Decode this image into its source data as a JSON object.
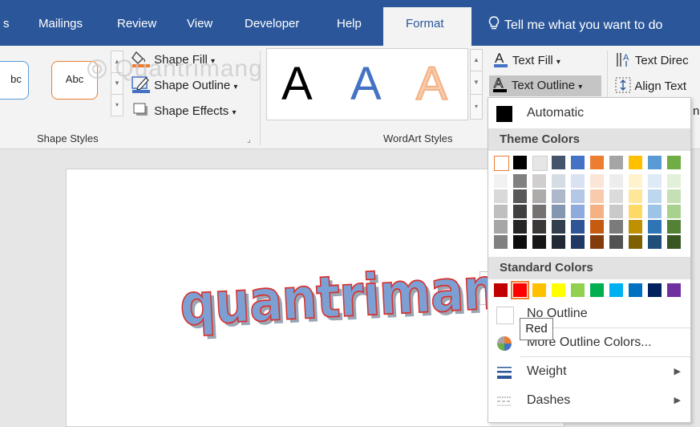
{
  "tabs": [
    "s",
    "Mailings",
    "Review",
    "View",
    "Developer",
    "Help"
  ],
  "active_tab": "Format",
  "tell_me": "Tell me what you want to do",
  "shape_styles": {
    "preset1": "bc",
    "preset2": "Abc",
    "shape_fill": "Shape Fill",
    "shape_outline": "Shape Outline",
    "shape_effects": "Shape Effects",
    "group_label": "Shape Styles"
  },
  "wordart_styles": {
    "samples": [
      "A",
      "A",
      "A"
    ],
    "group_label": "WordArt Styles",
    "text_fill": "Text Fill",
    "text_outline": "Text Outline",
    "text_effects_fragment": "n"
  },
  "text_group": {
    "text_direction": "Text Direc",
    "align_text": "Align Text"
  },
  "watermark": "Quantrimang",
  "document": {
    "wordart_text": "quantrimang"
  },
  "outline_menu": {
    "automatic": "Automatic",
    "theme_colors_header": "Theme Colors",
    "standard_colors_header": "Standard Colors",
    "no_outline": "No Outline",
    "more_colors": "More Outline Colors...",
    "weight": "Weight",
    "dashes": "Dashes",
    "tooltip": "Red"
  },
  "colors": {
    "ribbon_blue": "#2b579a",
    "theme_top": [
      "#ffffff",
      "#000000",
      "#e7e6e6",
      "#44546a",
      "#4472c4",
      "#ed7d31",
      "#a5a5a5",
      "#ffc000",
      "#5b9bd5",
      "#70ad47"
    ],
    "theme_shades": [
      [
        "#f2f2f2",
        "#d9d9d9",
        "#bfbfbf",
        "#a6a6a6",
        "#808080"
      ],
      [
        "#808080",
        "#595959",
        "#404040",
        "#262626",
        "#0d0d0d"
      ],
      [
        "#d0cece",
        "#aeabab",
        "#757171",
        "#3b3838",
        "#171616"
      ],
      [
        "#d6dce4",
        "#adb9ca",
        "#8497b0",
        "#333f4f",
        "#222a35"
      ],
      [
        "#d9e2f3",
        "#b4c7e7",
        "#8faadc",
        "#2f5597",
        "#1f3864"
      ],
      [
        "#fbe5d6",
        "#f8cbad",
        "#f4b183",
        "#c55a11",
        "#843c0c"
      ],
      [
        "#ededed",
        "#dbdbdb",
        "#c9c9c9",
        "#7b7b7b",
        "#525252"
      ],
      [
        "#fff2cc",
        "#ffe699",
        "#ffd966",
        "#bf9000",
        "#7f6000"
      ],
      [
        "#deebf7",
        "#bdd7ee",
        "#9dc3e6",
        "#2e75b6",
        "#1f4e79"
      ],
      [
        "#e2f0d9",
        "#c5e0b4",
        "#a9d18e",
        "#548235",
        "#385723"
      ]
    ],
    "standard": [
      "#c00000",
      "#ff0000",
      "#ffc000",
      "#ffff00",
      "#92d050",
      "#00b050",
      "#00b0f0",
      "#0070c0",
      "#002060",
      "#7030a0"
    ]
  }
}
